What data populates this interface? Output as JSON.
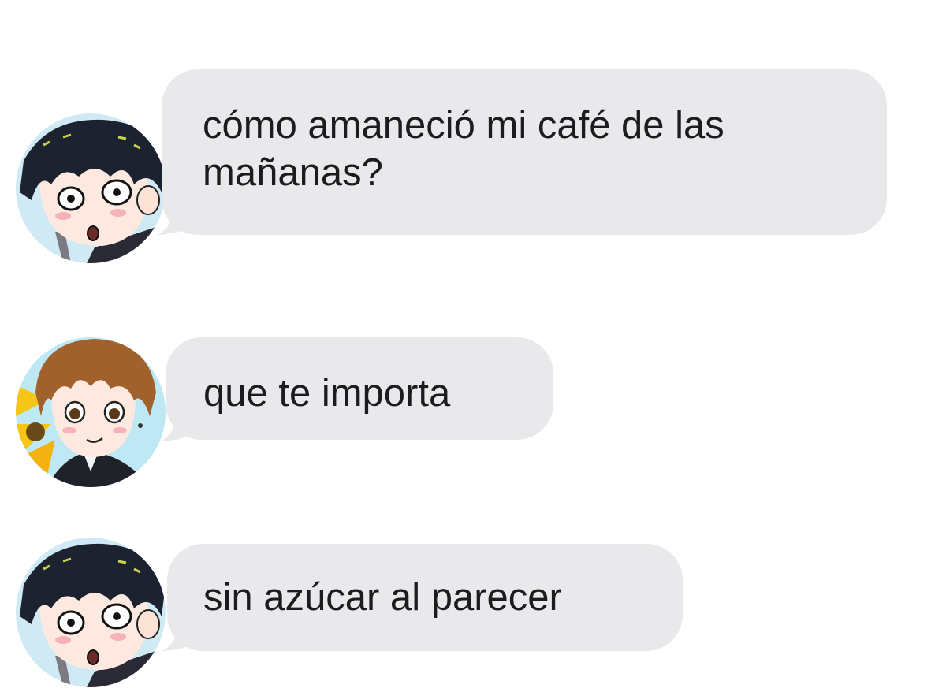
{
  "conversation": {
    "messages": [
      {
        "sender_avatar": "avatar-dark-hair-surprised",
        "text": "cómo amaneció mi café de las\nmañanas?"
      },
      {
        "sender_avatar": "avatar-brown-hair-smiling",
        "text": "que te importa"
      },
      {
        "sender_avatar": "avatar-dark-hair-surprised",
        "text": "sin azúcar al parecer"
      }
    ]
  },
  "colors": {
    "bubble_background": "#e9e9eb",
    "text": "#1c1c1e",
    "page_background": "#ffffff"
  }
}
